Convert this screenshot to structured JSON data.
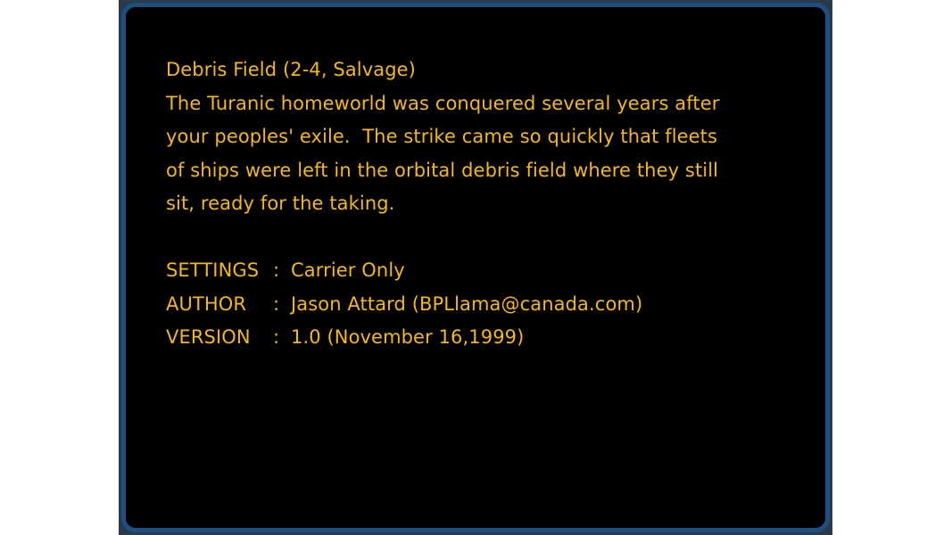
{
  "mission": {
    "title": "Debris Field (2-4, Salvage)",
    "description_lines": [
      "The Turanic homeworld was conquered several years after",
      "your peoples' exile.  The strike came so quickly that fleets",
      "of ships were left in the orbital debris field where they still",
      "sit, ready for the taking."
    ],
    "settings": {
      "label": "SETTINGS",
      "separator": ":",
      "value": "Carrier Only"
    },
    "author": {
      "label": "AUTHOR",
      "separator": ":",
      "value": "Jason Attard (BPLlama@canada.com)"
    },
    "version": {
      "label": "VERSION",
      "separator": ":",
      "value": "1.0 (November 16,1999)"
    }
  },
  "colors": {
    "text": "#f2b81c",
    "panel_border": "#1d4f82",
    "panel_background": "#000000"
  }
}
